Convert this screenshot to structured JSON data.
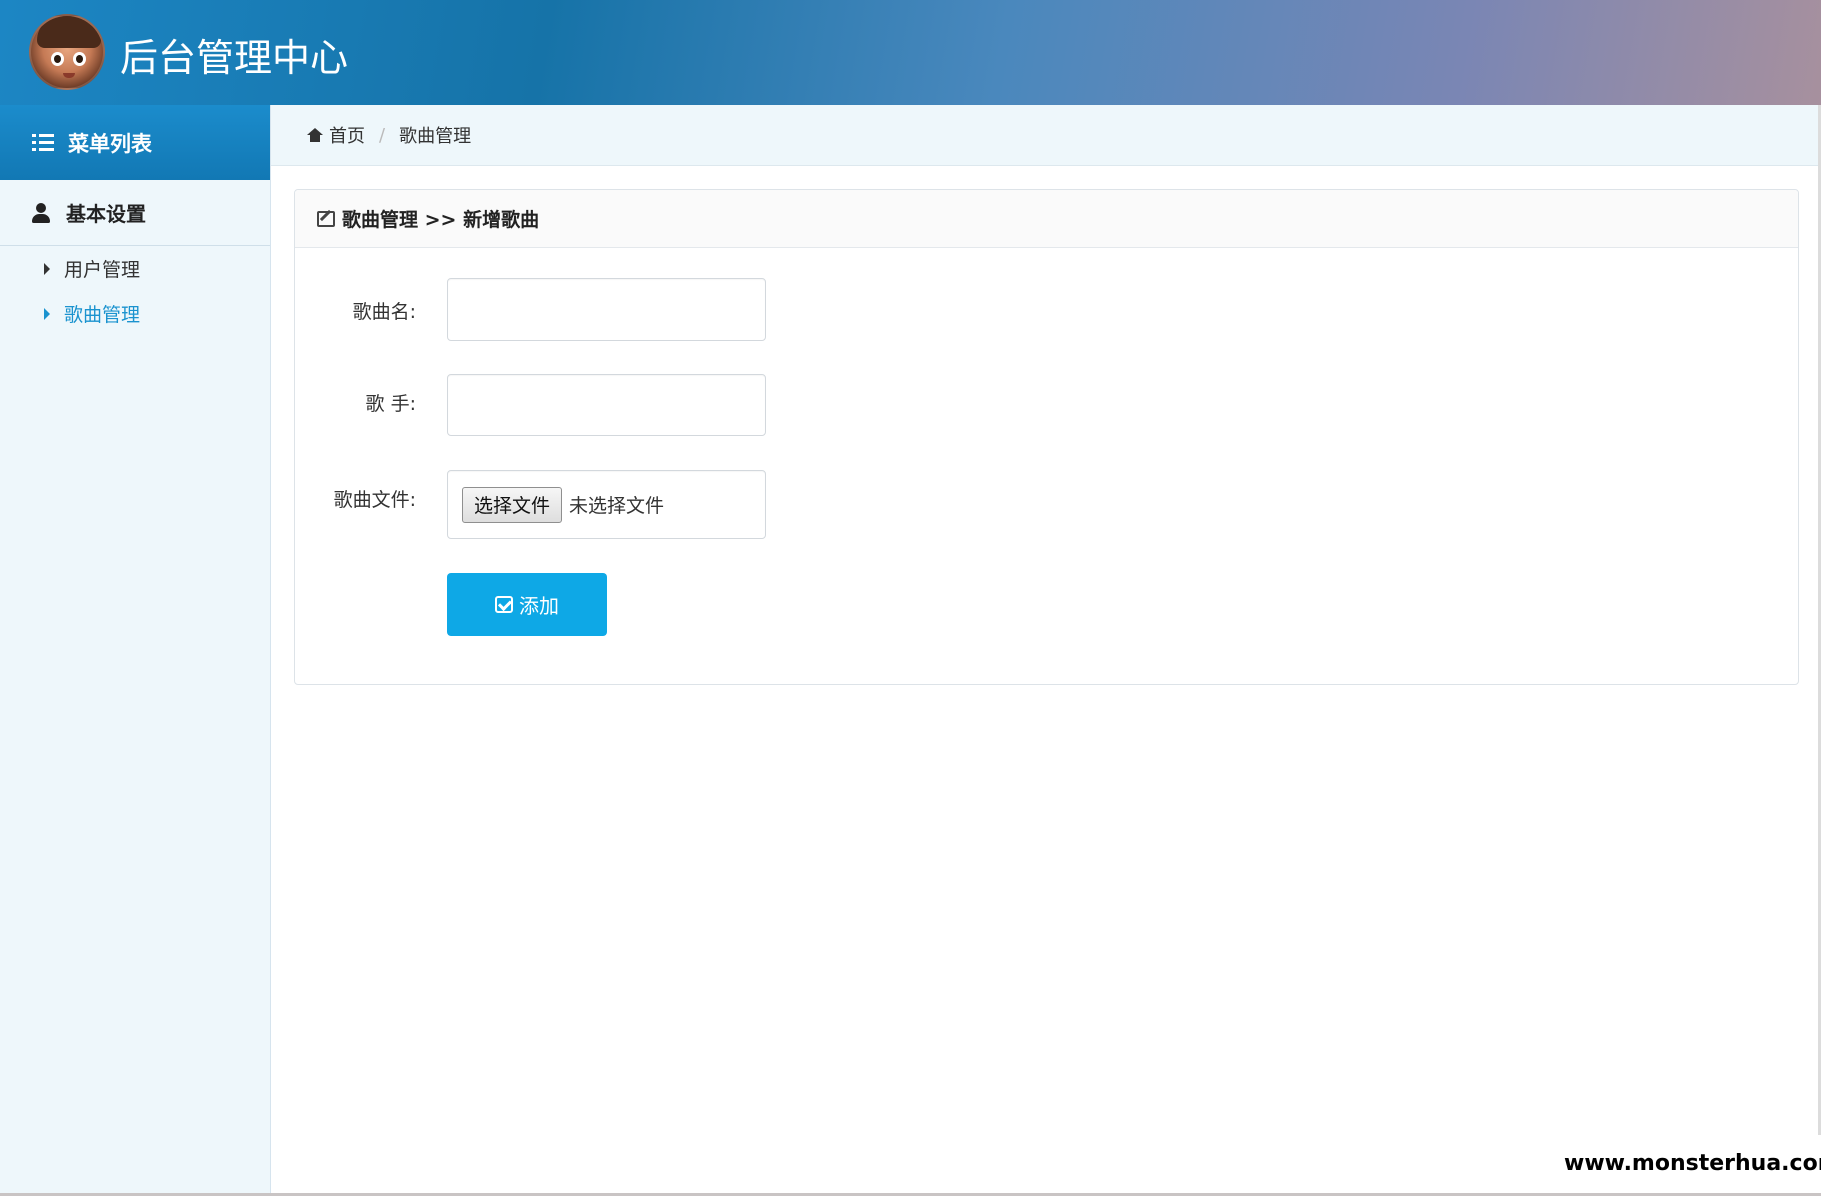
{
  "header": {
    "title": "后台管理中心"
  },
  "sidebar": {
    "menu_title": "菜单列表",
    "group_title": "基本设置",
    "items": [
      {
        "label": "用户管理",
        "active": false
      },
      {
        "label": "歌曲管理",
        "active": true
      }
    ]
  },
  "breadcrumb": {
    "home": "首页",
    "separator": "/",
    "current": "歌曲管理"
  },
  "panel": {
    "heading": "歌曲管理 >> 新增歌曲",
    "fields": {
      "song_name_label": "歌曲名:",
      "song_name_value": "",
      "singer_label": "歌 手:",
      "singer_value": "",
      "file_label": "歌曲文件:",
      "file_button": "选择文件",
      "file_status": "未选择文件"
    },
    "submit_label": "添加"
  },
  "watermark": "www.monsterhua.com",
  "colors": {
    "accent": "#0ea8e6",
    "active_link": "#1a93cf",
    "sidebar_bg": "#eef7fb"
  },
  "icons": [
    "avatar",
    "list-icon",
    "user-icon",
    "caret-right-icon",
    "home-icon",
    "edit-icon",
    "check-square-icon"
  ]
}
